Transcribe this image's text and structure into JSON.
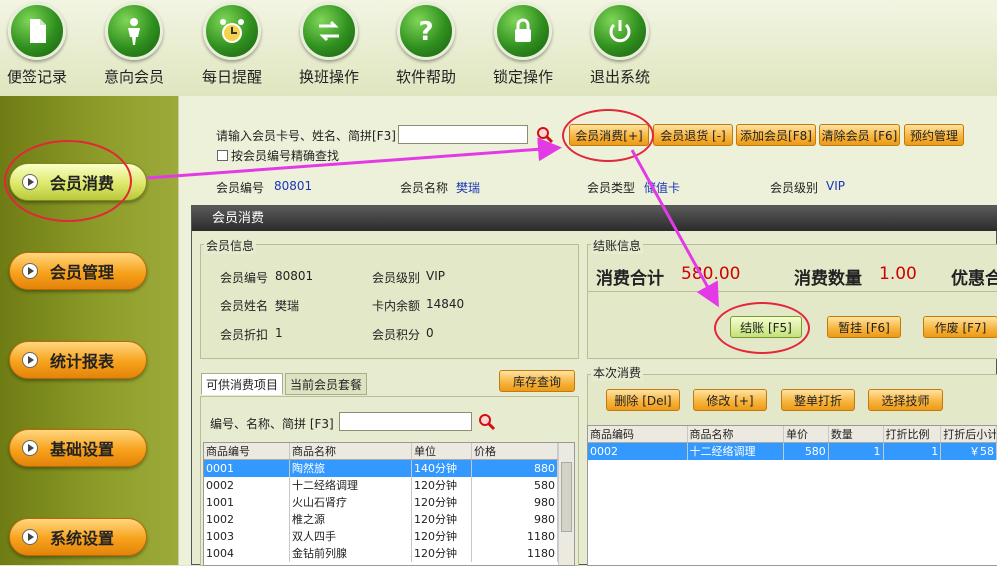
{
  "toolbar": [
    {
      "label": "便签记录",
      "icon": "document-icon"
    },
    {
      "label": "意向会员",
      "icon": "person-icon"
    },
    {
      "label": "每日提醒",
      "icon": "alarm-clock-icon"
    },
    {
      "label": "换班操作",
      "icon": "swap-arrows-icon"
    },
    {
      "label": "软件帮助",
      "icon": "question-icon"
    },
    {
      "label": "锁定操作",
      "icon": "lock-icon"
    },
    {
      "label": "退出系统",
      "icon": "power-icon"
    }
  ],
  "sidebar": {
    "items": [
      {
        "label": "会员消费",
        "active": true
      },
      {
        "label": "会员管理",
        "active": false
      },
      {
        "label": "统计报表",
        "active": false
      },
      {
        "label": "基础设置",
        "active": false
      },
      {
        "label": "系统设置",
        "active": false
      }
    ]
  },
  "search": {
    "label": "请输入会员卡号、姓名、简拼[F3]",
    "value": "",
    "exact_label": "按会员编号精确查找"
  },
  "actions": {
    "consume": "会员消费[+]",
    "refund": "会员退货 [-]",
    "add": "添加会员[F8]",
    "clear": "清除会员 [F6]",
    "reserve": "预约管理"
  },
  "member_bar": {
    "id_label": "会员编号",
    "id_value": "80801",
    "name_label": "会员名称",
    "name_value": "樊瑞",
    "type_label": "会员类型",
    "type_value": "储值卡",
    "level_label": "会员级别",
    "level_value": "VIP"
  },
  "dialog": {
    "title": "会员消费",
    "info": {
      "group_label": "会员信息",
      "id_label": "会员编号",
      "id_value": "80801",
      "level_label": "会员级别",
      "level_value": "VIP",
      "name_label": "会员姓名",
      "name_value": "樊瑞",
      "balance_label": "卡内余额",
      "balance_value": "14840",
      "discount_label": "会员折扣",
      "discount_value": "1",
      "points_label": "会员积分",
      "points_value": "0"
    },
    "checkout": {
      "group_label": "结账信息",
      "total_label": "消费合计",
      "total_value": "580.00",
      "qty_label": "消费数量",
      "qty_value": "1.00",
      "discount_label": "优惠合",
      "settle": "结账 [F5]",
      "hold": "暂挂 [F6]",
      "void": "作废 [F7]"
    },
    "tabs": [
      "可供消费项目",
      "当前会员套餐"
    ],
    "inventory_btn": "库存查询",
    "item_search_label": "编号、名称、简拼 [F3]",
    "item_search_value": "",
    "items": {
      "headers": [
        "商品编号",
        "商品名称",
        "单位",
        "价格"
      ],
      "rows": [
        [
          "0001",
          "陶然旅",
          "140分钟",
          "880"
        ],
        [
          "0002",
          "十二经络调理",
          "120分钟",
          "580"
        ],
        [
          "1001",
          "火山石肾疗",
          "120分钟",
          "980"
        ],
        [
          "1002",
          "椎之源",
          "120分钟",
          "980"
        ],
        [
          "1003",
          "双人四手",
          "120分钟",
          "1180"
        ],
        [
          "1004",
          "金钻前列腺",
          "120分钟",
          "1180"
        ]
      ]
    },
    "current": {
      "group_label": "本次消费",
      "delete": "删除 [Del]",
      "edit": "修改 [+]",
      "whole_discount": "整单打折",
      "choose_tech": "选择技师",
      "headers": [
        "商品编码",
        "商品名称",
        "单价",
        "数量",
        "打折比例",
        "打折后小计"
      ],
      "rows": [
        [
          "0002",
          "十二经络调理",
          "580",
          "1",
          "1",
          "￥58"
        ]
      ]
    }
  },
  "colors": {
    "accent_orange": "#f7a21c",
    "annotation_red": "#e3263a",
    "annotation_arrow": "#e23be6",
    "selection_blue": "#3399ff",
    "amount_red": "#d00000"
  }
}
